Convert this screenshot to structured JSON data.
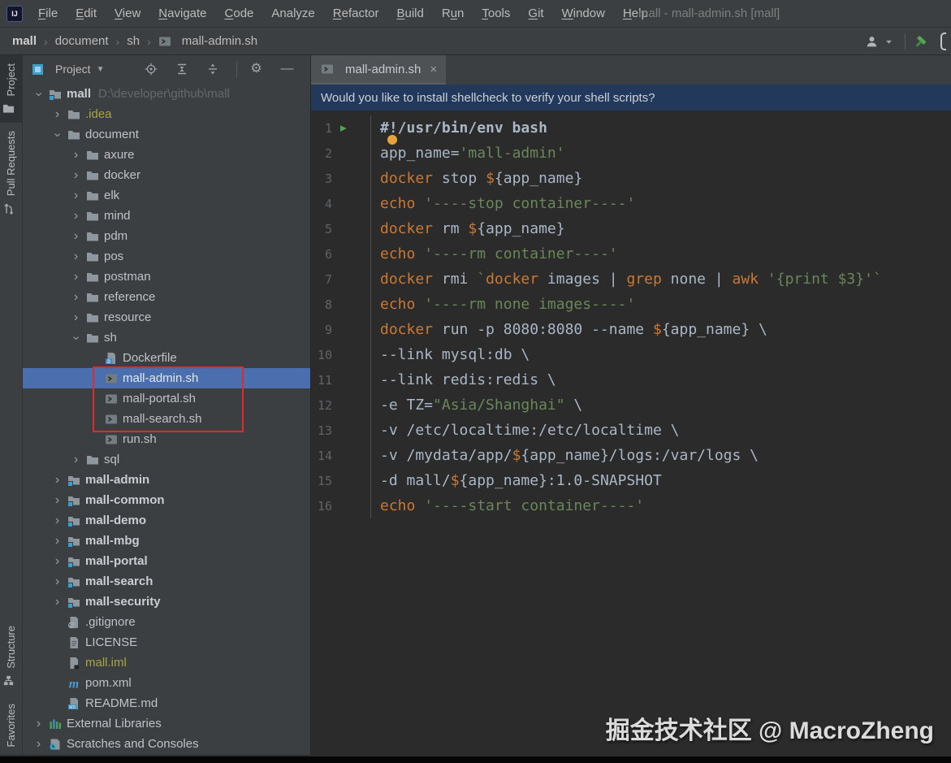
{
  "window": {
    "title": "mall - mall-admin.sh [mall]"
  },
  "menu": {
    "items": [
      {
        "label": "File",
        "u": 0
      },
      {
        "label": "Edit",
        "u": 0
      },
      {
        "label": "View",
        "u": 0
      },
      {
        "label": "Navigate",
        "u": 0
      },
      {
        "label": "Code",
        "u": 0
      },
      {
        "label": "Analyze",
        "u": -1
      },
      {
        "label": "Refactor",
        "u": 0
      },
      {
        "label": "Build",
        "u": 0
      },
      {
        "label": "Run",
        "u": 1
      },
      {
        "label": "Tools",
        "u": 0
      },
      {
        "label": "Git",
        "u": 0
      },
      {
        "label": "Window",
        "u": 0
      },
      {
        "label": "Help",
        "u": 0
      }
    ]
  },
  "breadcrumb": {
    "segments": [
      "mall",
      "document",
      "sh"
    ],
    "file": "mall-admin.sh"
  },
  "tool_windows": {
    "left_top": [
      {
        "label": "Project",
        "icon": "project-tab",
        "active": true
      },
      {
        "label": "Pull Requests",
        "icon": "pullrequest",
        "active": false
      }
    ],
    "left_bottom": [
      {
        "label": "Structure",
        "icon": "structure",
        "active": false
      },
      {
        "label": "Favorites",
        "icon": "",
        "active": false
      }
    ]
  },
  "project_panel": {
    "title": "Project",
    "header_icons": [
      "target",
      "expand-all",
      "collapse-all",
      "divider",
      "gear",
      "minus"
    ]
  },
  "tree": {
    "items": [
      {
        "label": "mall",
        "path": "D:\\developer\\github\\mall",
        "depth": 0,
        "chevron": "down",
        "icon": "module-folder",
        "bold": true
      },
      {
        "label": ".idea",
        "depth": 1,
        "chevron": "right",
        "icon": "folder",
        "style": "olive"
      },
      {
        "label": "document",
        "depth": 1,
        "chevron": "down",
        "icon": "folder"
      },
      {
        "label": "axure",
        "depth": 2,
        "chevron": "right",
        "icon": "folder"
      },
      {
        "label": "docker",
        "depth": 2,
        "chevron": "right",
        "icon": "folder"
      },
      {
        "label": "elk",
        "depth": 2,
        "chevron": "right",
        "icon": "folder"
      },
      {
        "label": "mind",
        "depth": 2,
        "chevron": "right",
        "icon": "folder"
      },
      {
        "label": "pdm",
        "depth": 2,
        "chevron": "right",
        "icon": "folder"
      },
      {
        "label": "pos",
        "depth": 2,
        "chevron": "right",
        "icon": "folder"
      },
      {
        "label": "postman",
        "depth": 2,
        "chevron": "right",
        "icon": "folder"
      },
      {
        "label": "reference",
        "depth": 2,
        "chevron": "right",
        "icon": "folder"
      },
      {
        "label": "resource",
        "depth": 2,
        "chevron": "right",
        "icon": "folder"
      },
      {
        "label": "sh",
        "depth": 2,
        "chevron": "down",
        "icon": "folder"
      },
      {
        "label": "Dockerfile",
        "depth": 3,
        "icon": "dockerfile"
      },
      {
        "label": "mall-admin.sh",
        "depth": 3,
        "icon": "shell",
        "selected": true
      },
      {
        "label": "mall-portal.sh",
        "depth": 3,
        "icon": "shell"
      },
      {
        "label": "mall-search.sh",
        "depth": 3,
        "icon": "shell"
      },
      {
        "label": "run.sh",
        "depth": 3,
        "icon": "shell"
      },
      {
        "label": "sql",
        "depth": 2,
        "chevron": "right",
        "icon": "folder"
      },
      {
        "label": "mall-admin",
        "depth": 1,
        "chevron": "right",
        "icon": "module-folder",
        "bold": true
      },
      {
        "label": "mall-common",
        "depth": 1,
        "chevron": "right",
        "icon": "module-folder",
        "bold": true
      },
      {
        "label": "mall-demo",
        "depth": 1,
        "chevron": "right",
        "icon": "module-folder",
        "bold": true
      },
      {
        "label": "mall-mbg",
        "depth": 1,
        "chevron": "right",
        "icon": "module-folder",
        "bold": true
      },
      {
        "label": "mall-portal",
        "depth": 1,
        "chevron": "right",
        "icon": "module-folder",
        "bold": true
      },
      {
        "label": "mall-search",
        "depth": 1,
        "chevron": "right",
        "icon": "module-folder",
        "bold": true
      },
      {
        "label": "mall-security",
        "depth": 1,
        "chevron": "right",
        "icon": "module-folder",
        "bold": true
      },
      {
        "label": ".gitignore",
        "depth": 1,
        "icon": "gitignore"
      },
      {
        "label": "LICENSE",
        "depth": 1,
        "icon": "textfile"
      },
      {
        "label": "mall.iml",
        "depth": 1,
        "icon": "iml",
        "style": "olive"
      },
      {
        "label": "pom.xml",
        "depth": 1,
        "icon": "maven"
      },
      {
        "label": "README.md",
        "depth": 1,
        "icon": "markdown"
      },
      {
        "label": "External Libraries",
        "depth": 0,
        "chevron": "right",
        "icon": "libs"
      },
      {
        "label": "Scratches and Consoles",
        "depth": 0,
        "chevron": "right",
        "icon": "scratches"
      }
    ]
  },
  "editor": {
    "tab": {
      "label": "mall-admin.sh",
      "icon": "shell",
      "close": "×"
    },
    "notification": "Would you like to install shellcheck to verify your shell scripts?",
    "lines": [
      {
        "n": 1,
        "run": true,
        "tokens": [
          [
            "#!/usr/bin/env bash",
            "b"
          ]
        ]
      },
      {
        "n": 2,
        "tokens": [
          [
            "app_name=",
            "d"
          ],
          [
            "'mall-admin'",
            "s"
          ]
        ]
      },
      {
        "n": 3,
        "tokens": [
          [
            "docker",
            "k"
          ],
          [
            " stop ",
            "d"
          ],
          [
            "$",
            "k"
          ],
          [
            "{app_name}",
            "d"
          ]
        ]
      },
      {
        "n": 4,
        "tokens": [
          [
            "echo",
            "k"
          ],
          [
            " ",
            "d"
          ],
          [
            "'----stop container----'",
            "s"
          ]
        ]
      },
      {
        "n": 5,
        "tokens": [
          [
            "docker",
            "k"
          ],
          [
            " rm ",
            "d"
          ],
          [
            "$",
            "k"
          ],
          [
            "{app_name}",
            "d"
          ]
        ]
      },
      {
        "n": 6,
        "tokens": [
          [
            "echo",
            "k"
          ],
          [
            " ",
            "d"
          ],
          [
            "'----rm container----'",
            "s"
          ]
        ]
      },
      {
        "n": 7,
        "tokens": [
          [
            "docker",
            "k"
          ],
          [
            " rmi ",
            "d"
          ],
          [
            "`",
            "s"
          ],
          [
            "docker",
            "k"
          ],
          [
            " images | ",
            "d"
          ],
          [
            "grep",
            "k"
          ],
          [
            " none | ",
            "d"
          ],
          [
            "awk",
            "k"
          ],
          [
            " ",
            "d"
          ],
          [
            "'{print $3}'",
            "s"
          ],
          [
            "`",
            "s"
          ]
        ]
      },
      {
        "n": 8,
        "tokens": [
          [
            "echo",
            "k"
          ],
          [
            " ",
            "d"
          ],
          [
            "'----rm none images----'",
            "s"
          ]
        ]
      },
      {
        "n": 9,
        "tokens": [
          [
            "docker",
            "k"
          ],
          [
            " run -p 8080:8080 --name ",
            "d"
          ],
          [
            "$",
            "k"
          ],
          [
            "{app_name}",
            "d"
          ],
          [
            " \\",
            "d"
          ]
        ]
      },
      {
        "n": 10,
        "tokens": [
          [
            "--link mysql:db \\",
            "d"
          ]
        ]
      },
      {
        "n": 11,
        "tokens": [
          [
            "--link redis:redis \\",
            "d"
          ]
        ]
      },
      {
        "n": 12,
        "tokens": [
          [
            "-e TZ=",
            "d"
          ],
          [
            "\"Asia/Shanghai\"",
            "s"
          ],
          [
            " \\",
            "d"
          ]
        ]
      },
      {
        "n": 13,
        "tokens": [
          [
            "-v /etc/localtime:/etc/localtime \\",
            "d"
          ]
        ]
      },
      {
        "n": 14,
        "tokens": [
          [
            "-v /mydata/app/",
            "d"
          ],
          [
            "$",
            "k"
          ],
          [
            "{app_name}",
            "d"
          ],
          [
            "/logs:/var/logs \\",
            "d"
          ]
        ]
      },
      {
        "n": 15,
        "tokens": [
          [
            "-d mall/",
            "d"
          ],
          [
            "$",
            "k"
          ],
          [
            "{app_name}",
            "d"
          ],
          [
            ":1.0-SNAPSHOT",
            "d"
          ]
        ]
      },
      {
        "n": 16,
        "tokens": [
          [
            "echo",
            "k"
          ],
          [
            " ",
            "d"
          ],
          [
            "'----start container----'",
            "s"
          ]
        ]
      }
    ]
  },
  "watermark": "掘金技术社区 @ MacroZheng",
  "colors": {
    "selection_blue": "#4B6EAF",
    "annotation_red": "#DE2B2B",
    "notification_bg": "#22395C",
    "command_orange": "#CB7832",
    "string_green": "#6A8759",
    "default_code": "#A9B7C6",
    "panel_bg": "#3C3F41",
    "editor_bg": "#2B2B2B"
  }
}
